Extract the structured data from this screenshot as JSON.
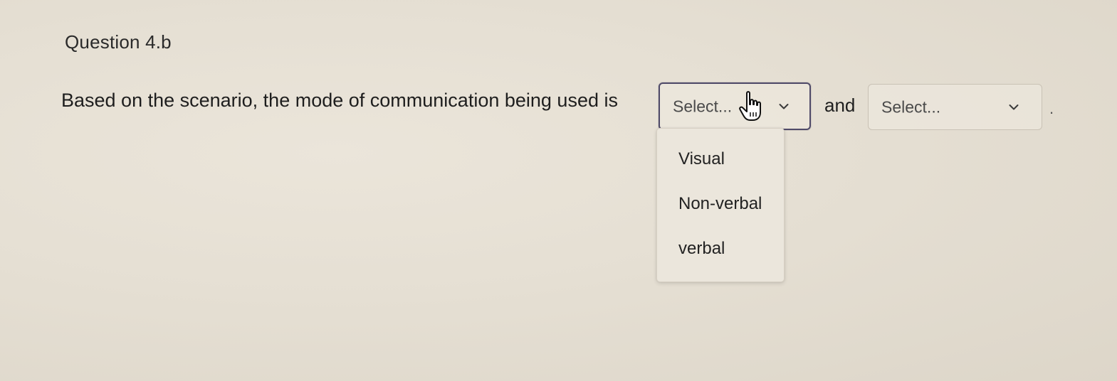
{
  "question": {
    "title": "Question 4.b",
    "prompt": "Based on the scenario, the mode of communication being used is",
    "connector": "and",
    "end_punctuation": "."
  },
  "dropdown_1": {
    "value": "Select...",
    "state": "expanded",
    "options": [
      "Visual",
      "Non-verbal",
      "verbal"
    ]
  },
  "dropdown_2": {
    "value": "Select...",
    "state": "collapsed"
  },
  "cursor": {
    "type": "hand-pointer-icon"
  },
  "colors": {
    "active_border": "#4f4a68",
    "inactive_border": "#c9c2b5",
    "background": "#e5dfd3"
  }
}
